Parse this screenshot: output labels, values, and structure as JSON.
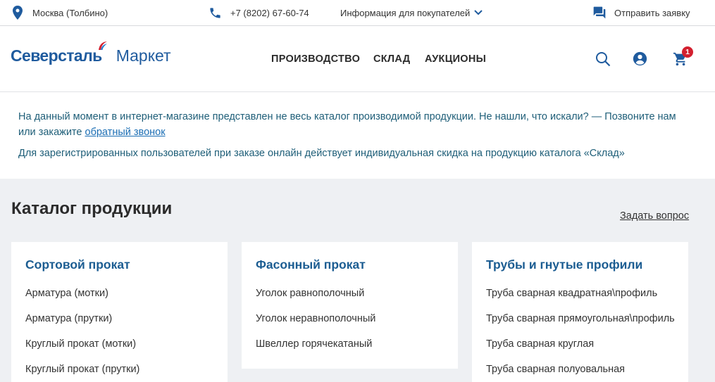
{
  "topbar": {
    "location": "Москва (Толбино)",
    "phone": "+7 (8202) 67-60-74",
    "info": "Информация для покупателей",
    "request": "Отправить заявку"
  },
  "header": {
    "brand": "Северсталь",
    "brand_sub": "Маркет",
    "nav": [
      "ПРОИЗВОДСТВО",
      "СКЛАД",
      "АУКЦИОНЫ"
    ],
    "cart_count": "1"
  },
  "notice": {
    "line1_text": "На данный момент в интернет-магазине представлен не весь каталог производимой продукции. Не нашли, что искали? — Позвоните нам или закажите ",
    "line1_link": "обратный звонок",
    "line2": "Для зарегистрированных пользователей при заказе онлайн действует индивидуальная скидка на продукцию каталога «Склад»"
  },
  "catalog": {
    "title": "Каталог продукции",
    "ask": "Задать вопрос",
    "cards": [
      {
        "title": "Сортовой прокат",
        "items": [
          "Арматура (мотки)",
          "Арматура (прутки)",
          "Круглый прокат (мотки)",
          "Круглый прокат (прутки)"
        ]
      },
      {
        "title": "Фасонный прокат",
        "items": [
          "Уголок равнополочный",
          "Уголок неравнополочный",
          "Швеллер горячекатаный"
        ]
      },
      {
        "title": "Трубы и гнутые профили",
        "items": [
          "Труба сварная квадратная\\профиль",
          "Труба сварная прямоугольная\\профиль",
          "Труба сварная круглая",
          "Труба сварная полуовальная"
        ]
      }
    ]
  },
  "colors": {
    "brand_blue": "#1f5b9e",
    "notice_text": "#1e5e78",
    "link": "#1b6eb4",
    "badge": "#d3202f",
    "page_bg": "#eef0f3"
  },
  "icons": [
    "location-pin-icon",
    "phone-icon",
    "chevron-down-icon",
    "chat-icon",
    "logo-mark-icon",
    "search-icon",
    "account-icon",
    "cart-icon"
  ]
}
